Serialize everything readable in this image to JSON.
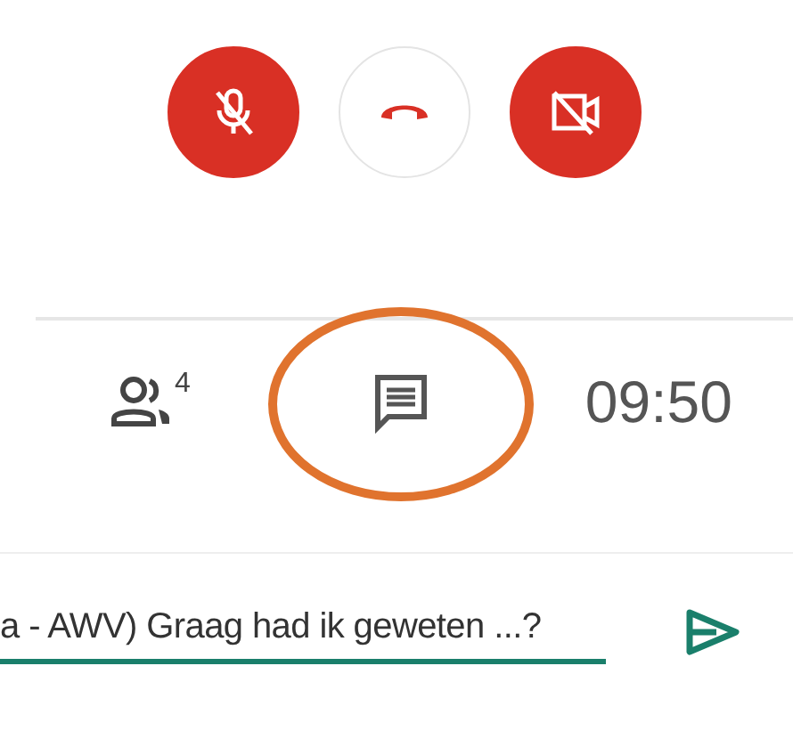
{
  "call_controls": {
    "microphone_muted": true,
    "camera_off": true
  },
  "tabs": [
    {
      "kind": "people",
      "badge": "4"
    },
    {
      "kind": "chat"
    },
    {
      "kind": "clock",
      "label": "09:50"
    }
  ],
  "message_field": {
    "value": "a - AWV) Graag had ik geweten ...?"
  }
}
